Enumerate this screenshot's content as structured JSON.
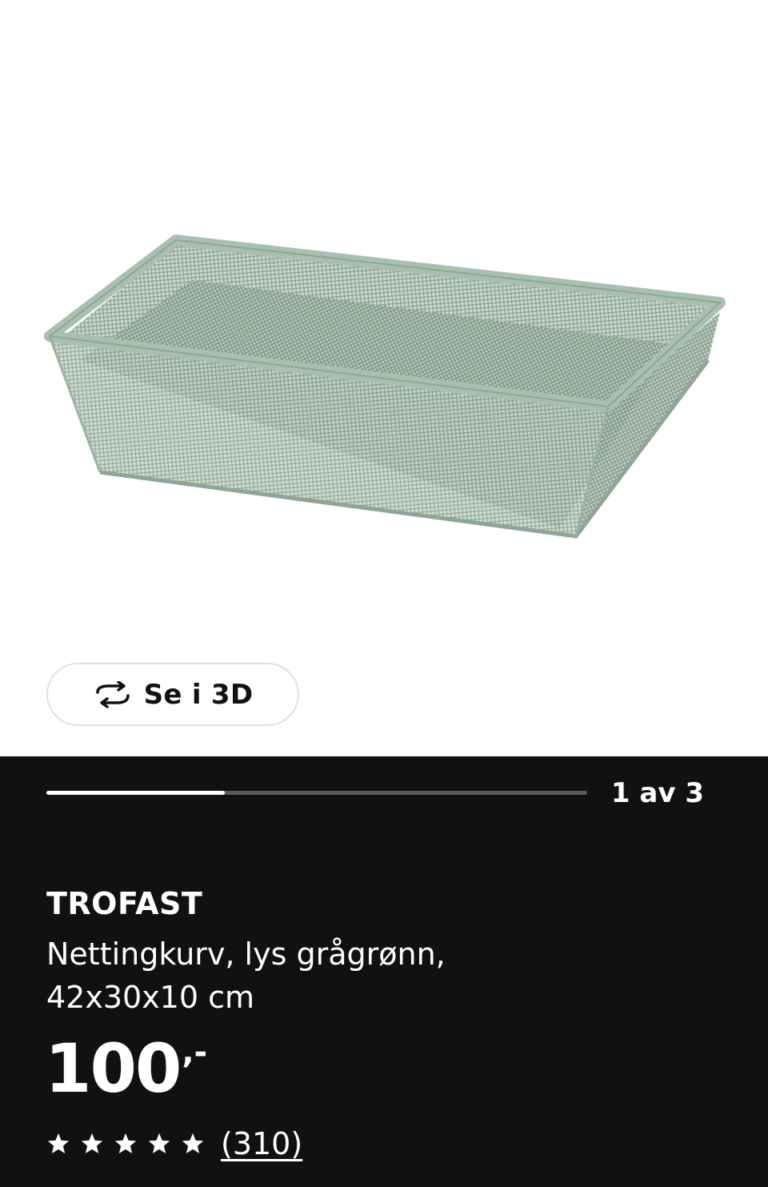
{
  "image_viewer": {
    "view_3d_label": "Se i 3D",
    "progress": 0.33,
    "page_indicator": "1 av 3",
    "colors": {
      "basket": "#a9bfb0",
      "basket_shadow": "#8fa596"
    }
  },
  "product": {
    "brand": "TROFAST",
    "description_line1": "Nettingkurv, lys grågrønn,",
    "description_line2": "42x30x10 cm",
    "price_main": "100",
    "price_suffix": ",-",
    "rating_stars": 5,
    "review_count": "(310)"
  },
  "icons": {
    "rotate": "rotate-3d-icon",
    "star": "star-icon"
  }
}
